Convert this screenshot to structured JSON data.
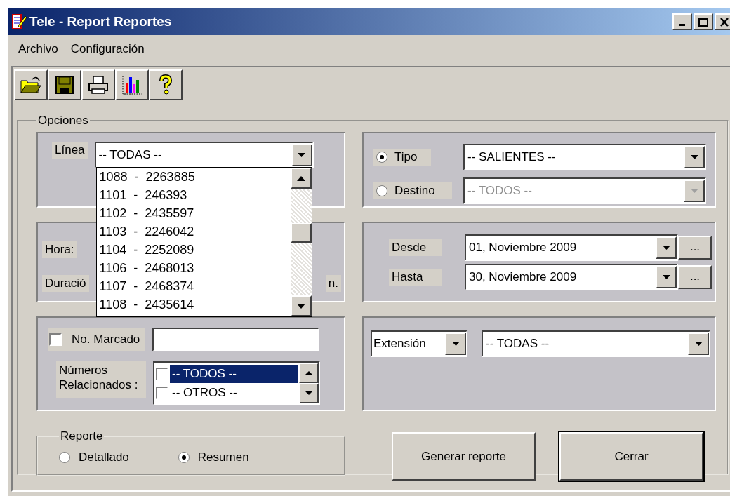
{
  "window": {
    "title": "Tele - Report  Reportes"
  },
  "menu": [
    {
      "label": "Archivo"
    },
    {
      "label": "Configuración"
    }
  ],
  "options": {
    "title": "Opciones",
    "linea": {
      "label": "Línea",
      "value": "-- TODAS --",
      "expanded": true,
      "items": [
        {
          "label": "1088  -  2263885"
        },
        {
          "label": "1101  -  246393"
        },
        {
          "label": "1102  -  2435597"
        },
        {
          "label": "1103  -  2246042"
        },
        {
          "label": "1104  -  2252089"
        },
        {
          "label": "1106  -  2468013"
        },
        {
          "label": "1107  -  2468374"
        },
        {
          "label": "1108  -  2435614"
        }
      ]
    },
    "hora_label": "Hora:",
    "duracion_label": "Duració",
    "duracion_suffix": "n.",
    "destination": [
      {
        "label": "Tipo",
        "selected": true,
        "value": "-- SALIENTES --",
        "disabled": false
      },
      {
        "label": "Destino",
        "selected": false,
        "value": "-- TODOS --",
        "disabled": true
      }
    ],
    "dates": [
      {
        "label": "Desde",
        "value": "01, Noviembre 2009",
        "button": "..."
      },
      {
        "label": "Hasta",
        "value": "30, Noviembre 2009",
        "button": "..."
      }
    ],
    "no_marcado": {
      "label": "No. Marcado",
      "checked": false
    },
    "numeros": {
      "label": "Números Relacionados :",
      "items": [
        {
          "label": "-- TODOS --",
          "checked": false,
          "selected": true
        },
        {
          "label": "-- OTROS --",
          "checked": false,
          "selected": false
        }
      ]
    },
    "extension": {
      "field": "Extensión",
      "value": "-- TODAS --"
    }
  },
  "reporte": {
    "title": "Reporte",
    "options": [
      {
        "label": "Detallado",
        "selected": false
      },
      {
        "label": "Resumen",
        "selected": true
      }
    ]
  },
  "buttons": [
    {
      "label": "Generar reporte",
      "default": false
    },
    {
      "label": "Cerrar",
      "default": true
    }
  ]
}
